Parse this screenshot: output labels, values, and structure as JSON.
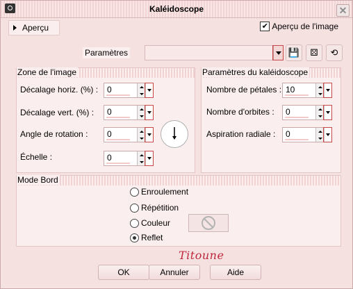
{
  "window": {
    "title": "Kaléidoscope",
    "close_glyph": "✕"
  },
  "preview": {
    "apercu_label": "Aperçu",
    "apercu_image_label": "Aperçu de l'image",
    "apercu_image_checked": true
  },
  "parameters": {
    "label": "Paramètres",
    "preset_value": "",
    "icons": [
      "save-icon",
      "dice-icon",
      "reset-icon"
    ]
  },
  "zone": {
    "title": "Zone de l'image",
    "horiz_label": "Décalage horiz. (%) :",
    "horiz_value": "0",
    "vert_label": "Décalage vert. (%) :",
    "vert_value": "0",
    "angle_label": "Angle de rotation :",
    "angle_value": "0",
    "scale_label": "Échelle :",
    "scale_value": "0"
  },
  "kaleido": {
    "title": "Paramètres du kaléidoscope",
    "petals_label": "Nombre de pétales :",
    "petals_value": "10",
    "orbits_label": "Nombre d'orbites :",
    "orbits_value": "0",
    "suction_label": "Aspiration radiale :",
    "suction_value": "0"
  },
  "mode_bord": {
    "title": "Mode Bord",
    "options": [
      {
        "label": "Enroulement",
        "checked": false
      },
      {
        "label": "Répétition",
        "checked": false
      },
      {
        "label": "Couleur",
        "checked": false
      },
      {
        "label": "Reflet",
        "checked": true
      }
    ]
  },
  "signature": "Titoune",
  "buttons": {
    "ok": "OK",
    "cancel": "Annuler",
    "help": "Aide"
  },
  "colors": {
    "accent": "#c84848",
    "signature": "#c0273c"
  }
}
